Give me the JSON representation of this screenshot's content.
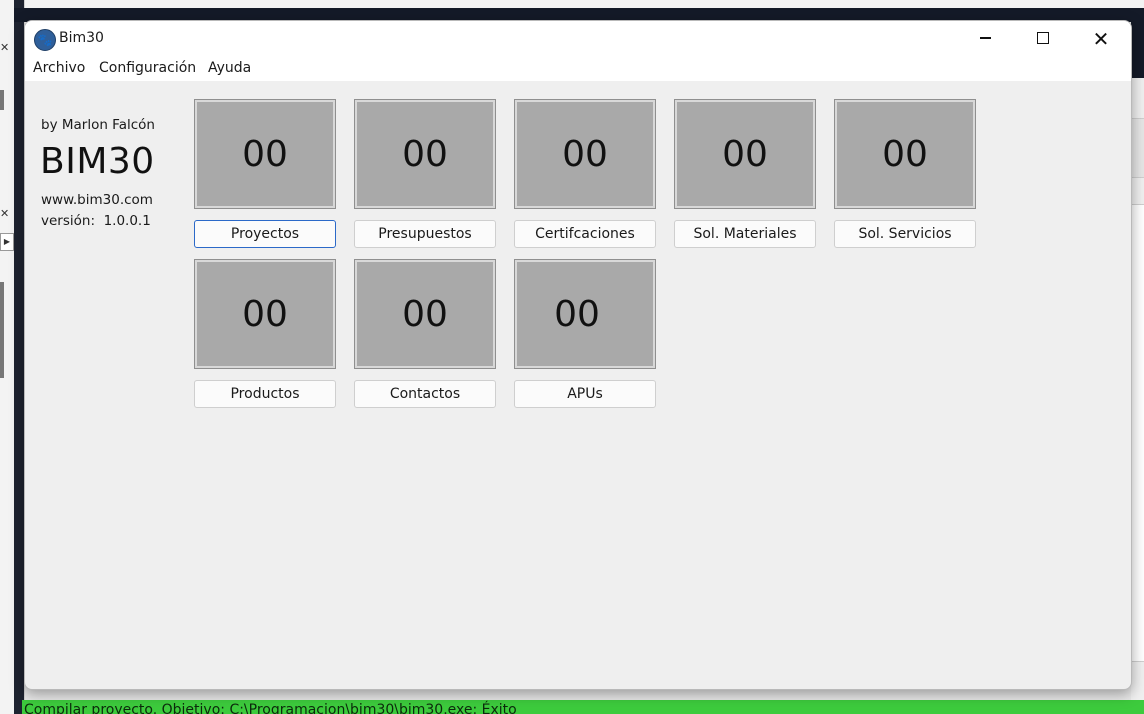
{
  "window": {
    "title": "Bim30",
    "minimize_icon": "minimize-icon",
    "maximize_icon": "maximize-icon",
    "close_icon": "close-icon"
  },
  "menu": [
    "Archivo",
    "Configuración",
    "Ayuda"
  ],
  "branding": {
    "by_line": "by Marlon Falcón",
    "name": "BIM30",
    "website": "www.bim30.com",
    "version": "versión:  1.0.0.1"
  },
  "tiles": [
    {
      "count": "00",
      "label": "Proyectos"
    },
    {
      "count": "00",
      "label": "Presupuestos"
    },
    {
      "count": "00",
      "label": "Certifcaciones"
    },
    {
      "count": "00",
      "label": "Sol. Materiales"
    },
    {
      "count": "00",
      "label": "Sol. Servicios"
    },
    {
      "count": "00",
      "label": "Productos"
    },
    {
      "count": "00",
      "label": "Contactos"
    },
    {
      "count": "00",
      "label": "APUs"
    }
  ],
  "ide": {
    "status_text": "Compilar proyecto. Objetivo: C:\\Programacion\\bim30\\bim30.exe: Éxito"
  },
  "colors": {
    "tile_bg": "#a9a9a9",
    "window_bg": "#efefef",
    "status_green": "#3dcb3d",
    "focus_border": "#2b69c8"
  }
}
